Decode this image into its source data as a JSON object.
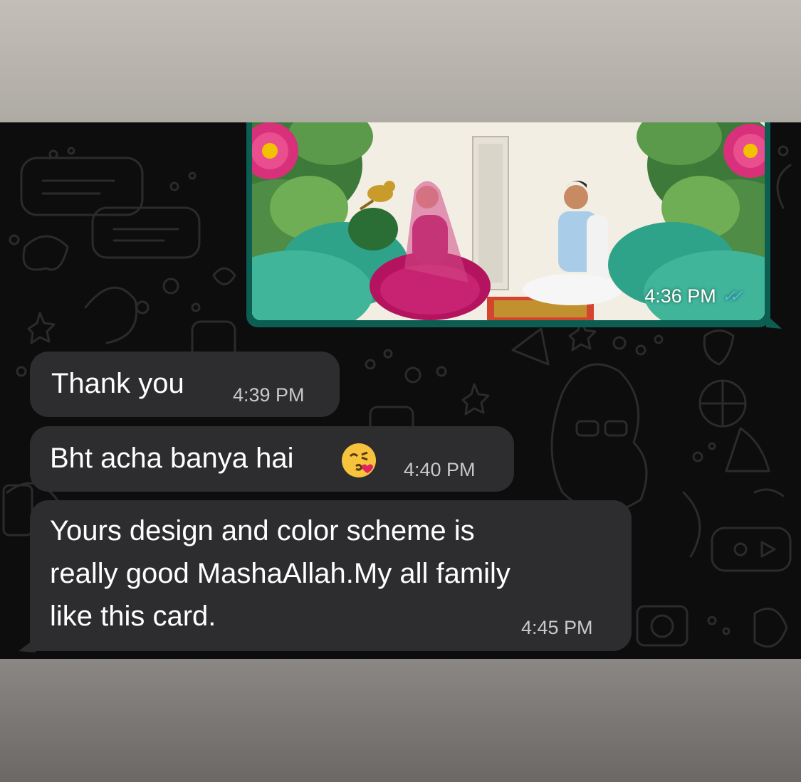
{
  "chat": {
    "background_color": "#0d0d0d",
    "bubble_color": "#2d2d2f",
    "outgoing_bubble_color": "#0d5e52",
    "read_tick_color": "#53bdeb"
  },
  "messages": [
    {
      "direction": "outgoing",
      "type": "image",
      "image_description_icon": "wedding-card-illustration",
      "time": "4:36 PM",
      "status_icon": "double-check-read-icon"
    },
    {
      "direction": "incoming",
      "type": "text",
      "text": "Thank you",
      "time": "4:39 PM"
    },
    {
      "direction": "incoming",
      "type": "text",
      "text": "Bht acha banya hai",
      "emoji": "kissing-face-emoji",
      "time": "4:40 PM"
    },
    {
      "direction": "incoming",
      "type": "text",
      "text_lines": [
        "Yours design and color scheme is",
        "really good MashaAllah.My all family",
        "like this card."
      ],
      "time": "4:45 PM"
    }
  ]
}
